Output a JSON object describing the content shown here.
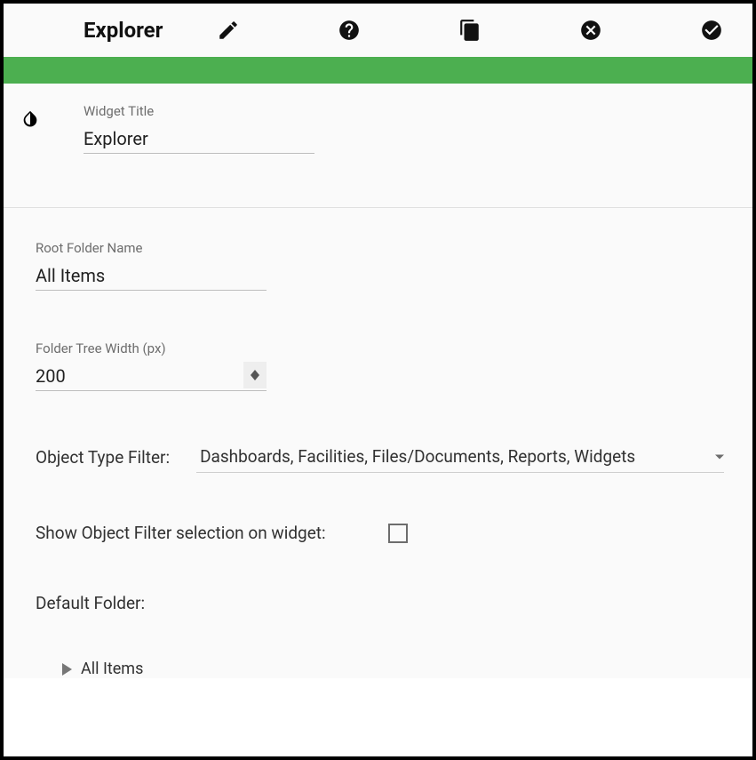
{
  "toolbar": {
    "title": "Explorer"
  },
  "widgetTitle": {
    "label": "Widget Title",
    "value": "Explorer"
  },
  "rootFolder": {
    "label": "Root Folder Name",
    "value": "All Items"
  },
  "treeWidth": {
    "label": "Folder Tree Width (px)",
    "value": "200"
  },
  "objectTypeFilter": {
    "label": "Object Type Filter:",
    "value": "Dashboards, Facilities, Files/Documents, Reports, Widgets"
  },
  "showFilter": {
    "label": "Show Object Filter selection on widget:"
  },
  "defaultFolder": {
    "label": "Default Folder:",
    "root": "All Items"
  }
}
